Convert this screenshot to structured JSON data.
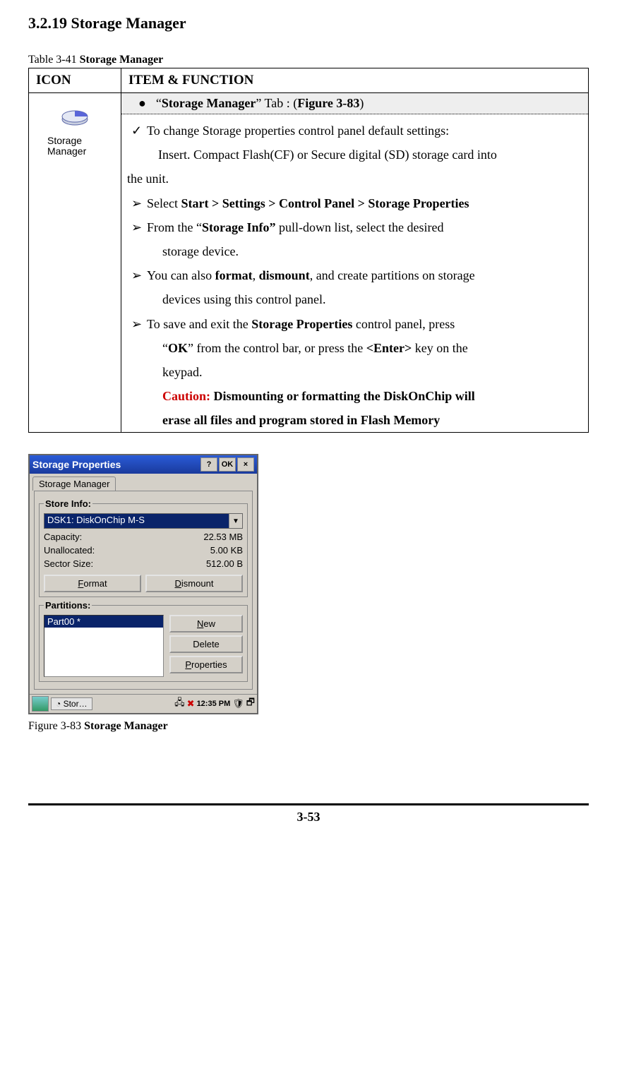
{
  "heading": "3.2.19 Storage Manager",
  "table_caption_prefix": "Table 3-41 ",
  "table_caption_bold": "Storage Manager",
  "th_icon": "ICON",
  "th_item": "ITEM & FUNCTION",
  "icon_label_line1": "Storage",
  "icon_label_line2": "Manager",
  "tab_header_prefix": "“",
  "tab_header_bold": "Storage Manager",
  "tab_header_mid": "” Tab : (",
  "tab_header_bold2": "Figure 3-83",
  "tab_header_suffix": ")",
  "li_check": "To change Storage properties control panel default settings:",
  "indent_line": "Insert. Compact Flash(CF) or Secure digital (SD) storage card into",
  "indent_line2": "the unit.",
  "li1_pre": "Select ",
  "li1_bold": "Start > Settings > Control Panel > Storage Properties",
  "li2_a": "From the “",
  "li2_bold": "Storage Info”",
  "li2_b": " pull-down list, select the desired",
  "li2_c": "storage device.",
  "li3_a": "You can also ",
  "li3_b1": "format",
  "li3_b_sep": ", ",
  "li3_b2": "dismount",
  "li3_c": ", and create partitions on storage",
  "li3_d": "devices using this control panel.",
  "li4_a": "To save and exit the ",
  "li4_bold1": "Storage Properties",
  "li4_b": " control panel, press",
  "li4_c_a": "“",
  "li4_c_bold": "OK",
  "li4_c_b": "” from the control bar, or press the ",
  "li4_c_bold2": "<Enter>",
  "li4_c_c": " key on the",
  "li4_d": "keypad.",
  "caution_label": "Caution:",
  "caution_a": " Dismounting or formatting the DiskOnChip will",
  "caution_b": "erase all files and program stored in Flash Memory",
  "fig_prefix": "Figure 3-83 ",
  "fig_bold": "Storage Manager",
  "page_num": "3-53",
  "markers": {
    "bullet": "●",
    "check": "✓",
    "arrow": "➢"
  },
  "screenshot": {
    "title": "Storage Properties",
    "help_btn": "?",
    "ok_btn": "OK",
    "close_btn": "×",
    "tab": "Storage Manager",
    "group1": "Store Info:",
    "ddl_selected": "DSK1: DiskOnChip M-S",
    "kv": [
      {
        "k": "Capacity:",
        "v": "22.53 MB"
      },
      {
        "k": "Unallocated:",
        "v": "5.00 KB"
      },
      {
        "k": "Sector Size:",
        "v": "512.00 B"
      }
    ],
    "btn_format": "Format",
    "btn_dismount": "Dismount",
    "group2": "Partitions:",
    "part_item": "Part00 *",
    "btn_new": "New",
    "btn_delete": "Delete",
    "btn_properties": "Properties",
    "task_label": "Stor…",
    "tray_time": "12:35 PM"
  }
}
